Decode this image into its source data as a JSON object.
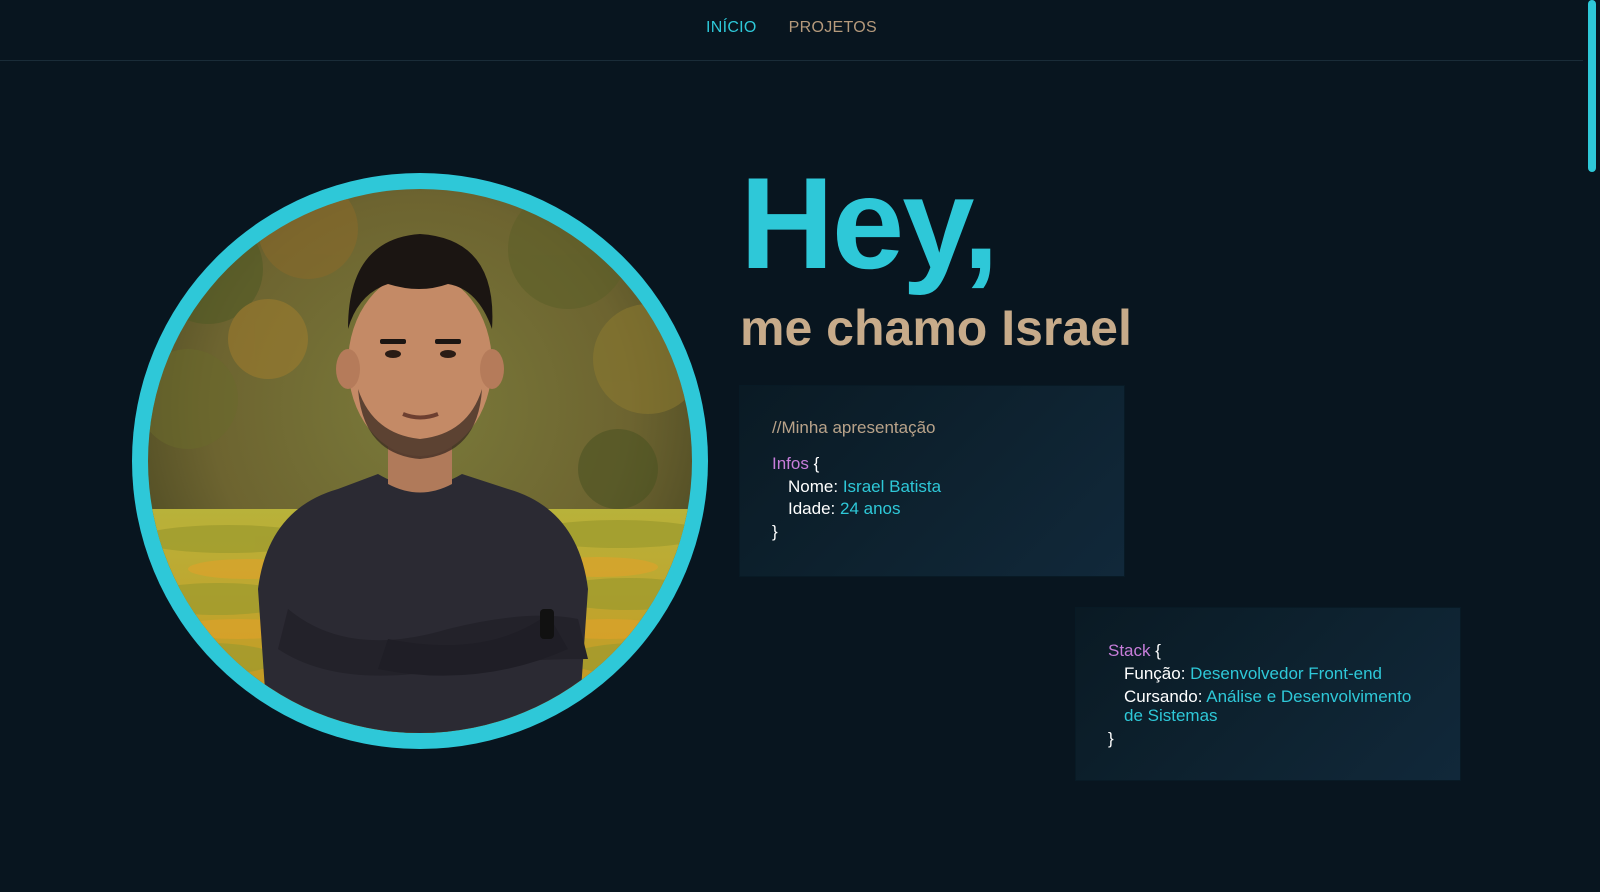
{
  "nav": {
    "items": [
      {
        "label": "INÍCIO",
        "active": true
      },
      {
        "label": "PROJETOS",
        "active": false
      }
    ]
  },
  "hero": {
    "greeting": "Hey,",
    "subtitle": "me chamo Israel"
  },
  "info_card": {
    "comment": "//Minha apresentação",
    "keyword": "Infos",
    "open_brace": "{",
    "close_brace": "}",
    "fields": [
      {
        "key": "Nome:",
        "value": "Israel Batista"
      },
      {
        "key": "Idade:",
        "value": "24 anos"
      }
    ]
  },
  "stack_card": {
    "keyword": "Stack",
    "open_brace": "{",
    "close_brace": "}",
    "fields": [
      {
        "key": "Função:",
        "value": "Desenvolvedor Front-end"
      },
      {
        "key": "Cursando:",
        "value": "Análise e Desenvolvimento de Sistemas"
      }
    ]
  },
  "colors": {
    "accent": "#2ec8d8",
    "background": "#08151f",
    "keyword": "#c77dda",
    "muted": "#c7ab8a"
  }
}
